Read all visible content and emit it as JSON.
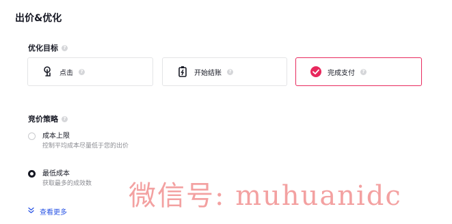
{
  "section": {
    "title": "出价&优化"
  },
  "goal": {
    "label": "优化目标",
    "options": [
      {
        "label": "点击",
        "icon": "tap-icon",
        "selected": false
      },
      {
        "label": "开始结账",
        "icon": "checkout-icon",
        "selected": false
      },
      {
        "label": "完成支付",
        "icon": "check-circle-icon",
        "selected": true
      }
    ]
  },
  "strategy": {
    "label": "竞价策略",
    "options": [
      {
        "title": "成本上限",
        "desc": "控制平均成本尽量低于您的出价",
        "checked": false
      },
      {
        "title": "最低成本",
        "desc": "获取最多的成效数",
        "checked": true
      }
    ]
  },
  "more": {
    "label": "查看更多",
    "icon": "double-chevron-down-icon"
  },
  "watermark": {
    "text": "微信号: muhuanidc"
  },
  "colors": {
    "accent": "#e8285d",
    "link": "#2a55e5",
    "text": "#161823",
    "muted": "#8a8b91",
    "border": "#e3e4e6"
  }
}
